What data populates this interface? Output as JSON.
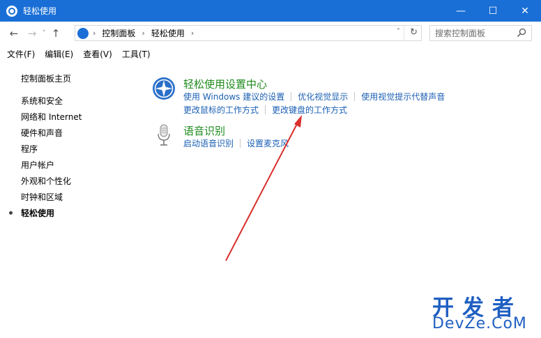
{
  "window": {
    "title": "轻松使用",
    "controls": {
      "minimize": "—",
      "maximize": "☐",
      "close": "✕"
    }
  },
  "addressbar": {
    "back": "←",
    "forward": "→",
    "recent": "˅",
    "up": "↑",
    "breadcrumbs": [
      "控制面板",
      "轻松使用"
    ],
    "separator": "›",
    "dropdown": "˅",
    "refresh": "↻"
  },
  "search": {
    "placeholder": "搜索控制面板"
  },
  "menubar": {
    "items": [
      "文件(F)",
      "编辑(E)",
      "查看(V)",
      "工具(T)"
    ]
  },
  "sidebar": {
    "items": [
      "控制面板主页",
      "系统和安全",
      "网络和 Internet",
      "硬件和声音",
      "程序",
      "用户帐户",
      "外观和个性化",
      "时钟和区域",
      "轻松使用"
    ],
    "active_index": 8
  },
  "sections": [
    {
      "icon": "ease-of-access-icon",
      "heading": "轻松使用设置中心",
      "links_row1": [
        "使用 Windows 建议的设置",
        "优化视觉显示",
        "使用视觉提示代替声音"
      ],
      "links_row2": [
        "更改鼠标的工作方式",
        "更改键盘的工作方式"
      ]
    },
    {
      "icon": "microphone-icon",
      "heading": "语音识别",
      "links_row1": [
        "启动语音识别",
        "设置麦克风"
      ]
    }
  ],
  "watermark": {
    "cn": "开发者",
    "en": "DevZe.CoM"
  },
  "colors": {
    "titlebar": "#1a6fd6",
    "heading": "#1e8a1e",
    "link": "#1a5fb4",
    "arrow": "#d9302c"
  }
}
